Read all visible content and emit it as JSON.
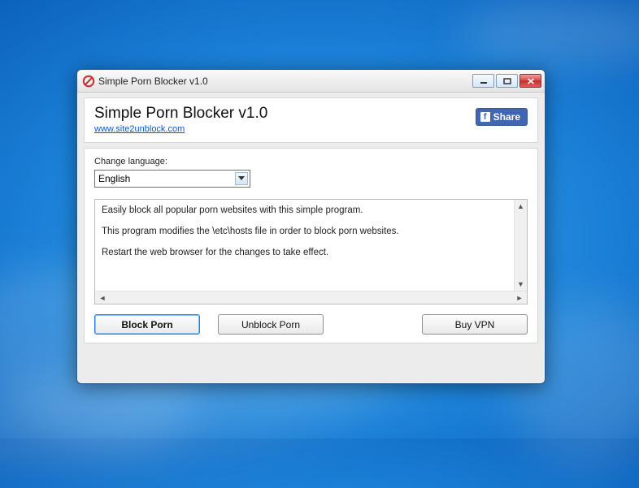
{
  "titlebar": {
    "title": "Simple Porn Blocker v1.0"
  },
  "header": {
    "app_title": "Simple Porn Blocker v1.0",
    "website_link": "www.site2unblock.com",
    "fb_share_label": "Share"
  },
  "language": {
    "label": "Change language:",
    "selected": "English"
  },
  "info": {
    "line1": "Easily block all popular porn websites with this simple program.",
    "line2": "This program modifies the \\etc\\hosts file in order to block porn websites.",
    "line3": "Restart the web browser for the changes to take effect."
  },
  "buttons": {
    "block": "Block Porn",
    "unblock": "Unblock Porn",
    "buy_vpn": "Buy VPN"
  }
}
